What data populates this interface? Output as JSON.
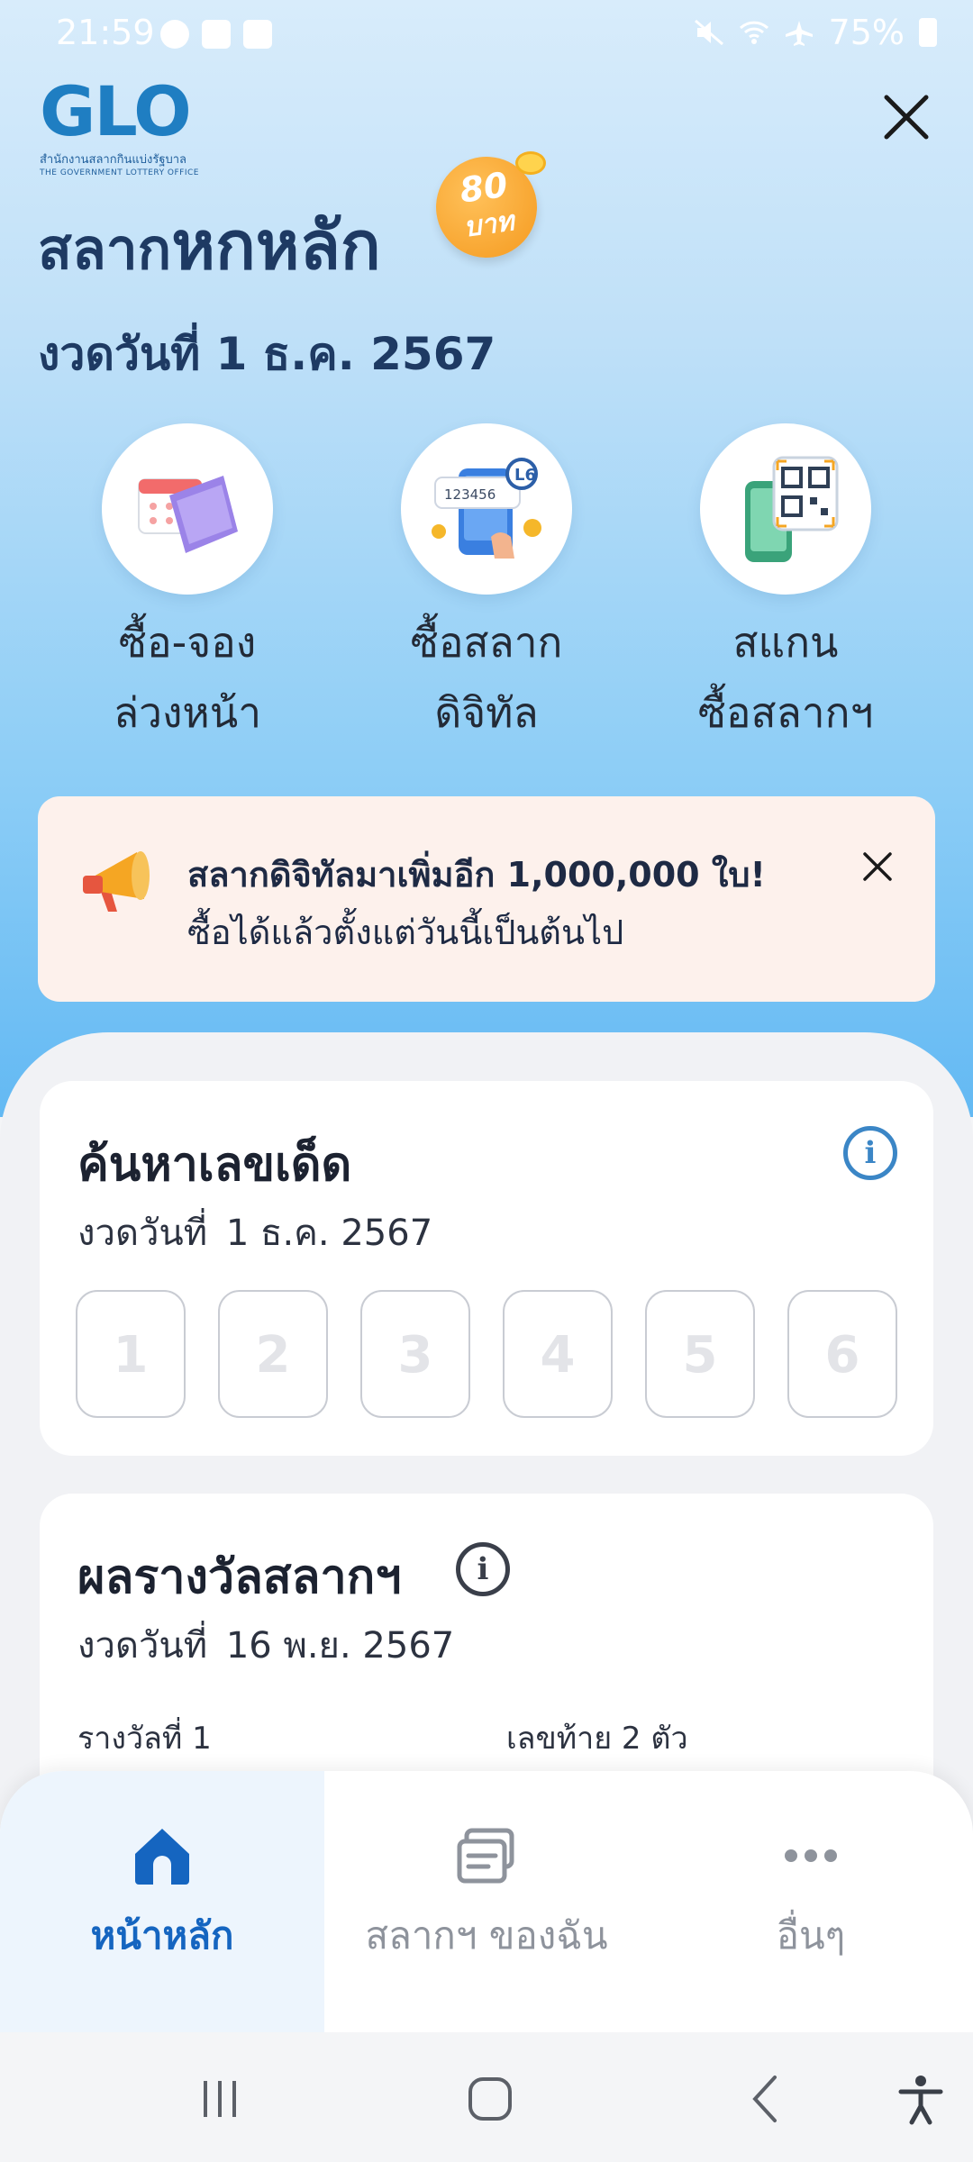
{
  "status_bar": {
    "time": "21:59",
    "battery": "75%"
  },
  "header": {
    "logo_text": "GLO",
    "logo_subtitle_th": "สำนักงานสลากกินแบ่งรัฐบาล",
    "logo_subtitle_en": "THE GOVERNMENT LOTTERY OFFICE",
    "title_prefix": "สลาก",
    "title_main": "หกหลัก",
    "price_value": "80",
    "price_unit": "บาท",
    "draw_date": "งวดวันที่ 1 ธ.ค. 2567"
  },
  "shortcuts": [
    {
      "line1": "ซื้อ-จอง",
      "line2": "ล่วงหน้า",
      "icon": "calendar-ticket-icon"
    },
    {
      "line1": "ซื้อสลาก",
      "line2": "ดิจิทัล",
      "icon": "digital-ticket-phone-icon"
    },
    {
      "line1": "สแกน",
      "line2": "ซื้อสลากฯ",
      "icon": "qr-scan-phone-icon"
    }
  ],
  "banner": {
    "title": "สลากดิจิทัลมาเพิ่มอีก 1,000,000 ใบ!",
    "subtitle": "ซื้อได้แล้วตั้งแต่วันนี้เป็นต้นไป",
    "icon": "megaphone-icon"
  },
  "search_card": {
    "title": "ค้นหาเลขเด็ด",
    "date_label": "งวดวันที่",
    "date_value": "1 ธ.ค. 2567",
    "digit_placeholders": [
      "1",
      "2",
      "3",
      "4",
      "5",
      "6"
    ]
  },
  "results_card": {
    "title": "ผลรางวัลสลากฯ",
    "date_label": "งวดวันที่",
    "date_value": "16 พ.ย. 2567",
    "prize1_label": "รางวัลที่ 1",
    "last2_label": "เลขท้าย 2 ตัว"
  },
  "bottom_nav": {
    "home": "หน้าหลัก",
    "my_tickets": "สลากฯ ของฉัน",
    "more": "อื่นๆ"
  },
  "colors": {
    "accent": "#1565c0",
    "title": "#1e3a63",
    "badge": "#f59a1f",
    "banner_bg": "#fdf1ec"
  }
}
